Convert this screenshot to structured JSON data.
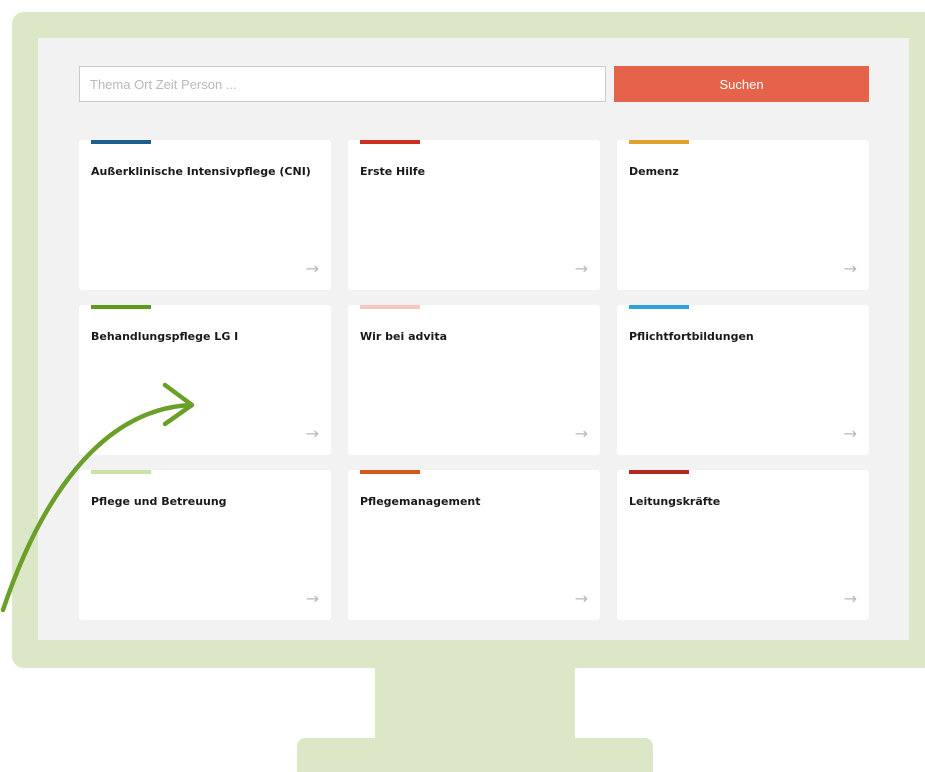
{
  "search": {
    "placeholder": "Thema Ort Zeit Person ...",
    "button_label": "Suchen",
    "button_color": "#e5634a"
  },
  "categories": [
    {
      "label": "Außerklinische Intensivpflege (CNI)",
      "accent": "#1a5f8e"
    },
    {
      "label": "Erste Hilfe",
      "accent": "#c8321f"
    },
    {
      "label": "Demenz",
      "accent": "#e0a22a"
    },
    {
      "label": "Behandlungspflege LG I",
      "accent": "#5e9a1e"
    },
    {
      "label": "Wir bei advita",
      "accent": "#f7c6bc"
    },
    {
      "label": "Pflichtfortbildungen",
      "accent": "#2ea1d9"
    },
    {
      "label": "Pflege und Betreuung",
      "accent": "#c9e2a6"
    },
    {
      "label": "Pflegemanagement",
      "accent": "#d05a1a"
    },
    {
      "label": "Leitungskräfte",
      "accent": "#b3281f"
    }
  ],
  "card_arrow_glyph": "→",
  "decoration": {
    "arrow_color": "#6aa02a",
    "monitor_color": "#dbe7c6"
  }
}
